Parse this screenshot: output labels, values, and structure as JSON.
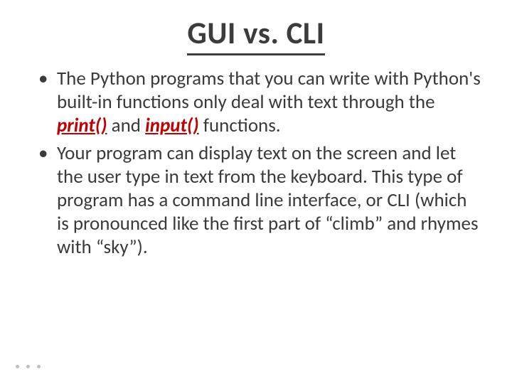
{
  "title": {
    "text": "GUI vs. CLI"
  },
  "bullets": [
    {
      "t1": "The Python programs that you can write with Python's built-in functions only deal with text through the ",
      "fn1": "print()",
      "t2": " and ",
      "fn2": "input()",
      "t3": " functions."
    },
    {
      "t1": "Your program can display text on the screen and let the user type in text from the keyboard. This type of program has a command line interface, or CLI (which is pronounced like the first part of “climb” and rhymes with “sky”)."
    }
  ]
}
